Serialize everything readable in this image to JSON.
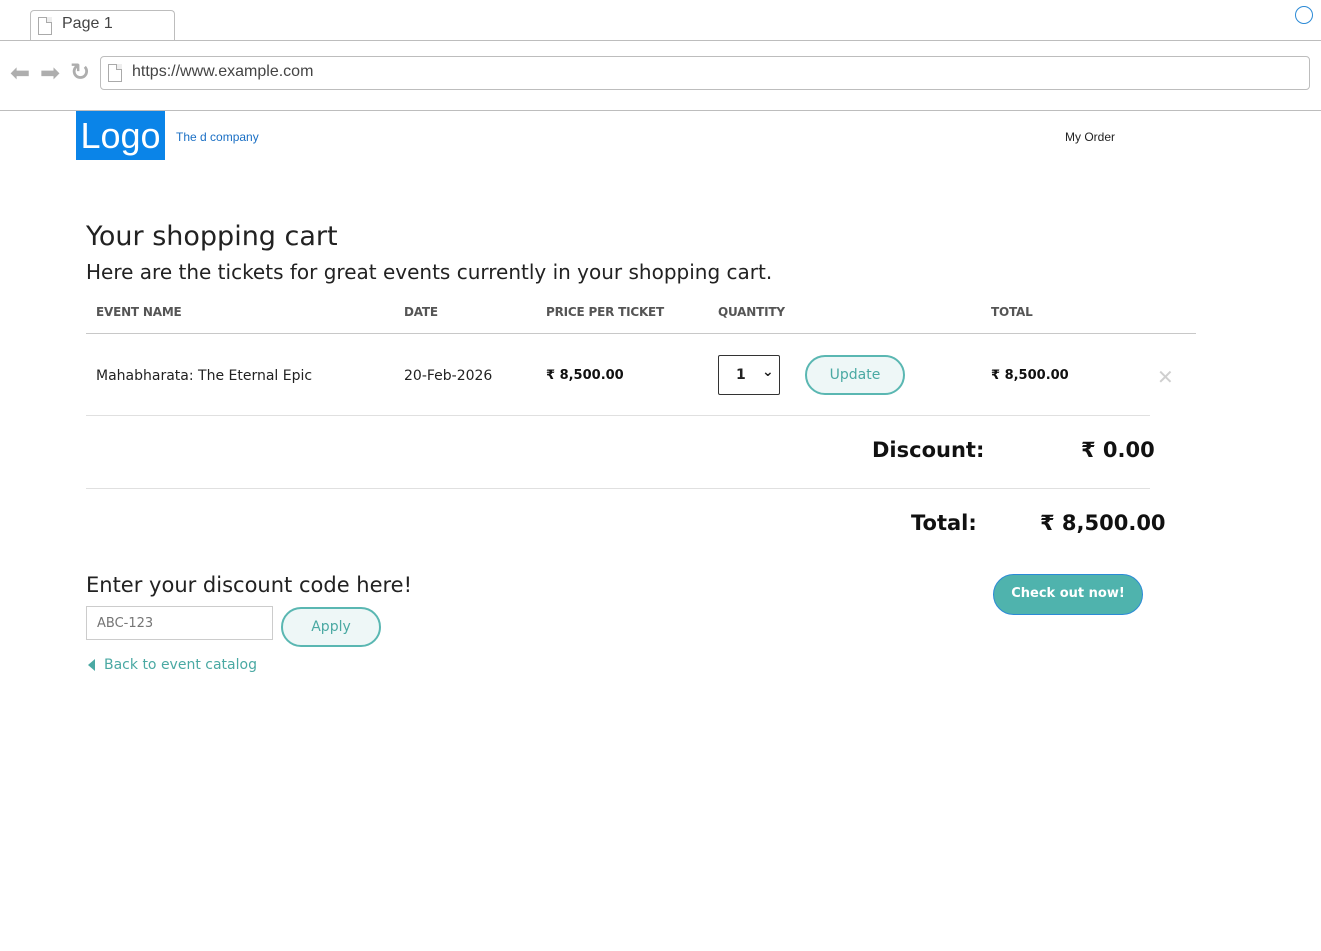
{
  "browser": {
    "tab_label": "Page 1",
    "url": "https://www.example.com"
  },
  "header": {
    "logo_text": "Logo",
    "company": "The d company",
    "my_order": "My Order"
  },
  "cart": {
    "title": "Your shopping cart",
    "subtitle": "Here are the tickets for great events currently in your shopping cart.",
    "columns": [
      "EVENT NAME",
      "DATE",
      "PRICE PER TICKET",
      "QUANTITY",
      "TOTAL"
    ],
    "rows": [
      {
        "event_name": "Mahabharata: The Eternal Epic",
        "date": "20-Feb-2026",
        "price": "₹ 8,500.00",
        "quantity": "1",
        "update_label": "Update",
        "total": "₹ 8,500.00"
      }
    ],
    "discount_label": "Discount:",
    "discount_value": "₹ 0.00",
    "total_label": "Total:",
    "total_value": "₹ 8,500.00"
  },
  "discount_code": {
    "heading": "Enter your discount code here!",
    "placeholder": "ABC-123",
    "apply_label": "Apply"
  },
  "back_link": "Back to event catalog",
  "checkout_label": "Check out now!"
}
